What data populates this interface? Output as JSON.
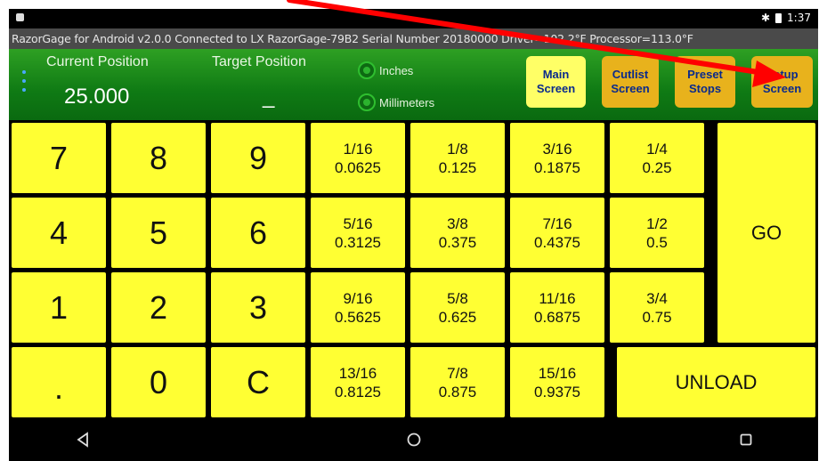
{
  "status_bar": {
    "time": "1:37"
  },
  "info_bar": {
    "text": "RazorGage for Android v2.0.0  Connected to LX RazorGage-79B2  Serial Number 20180000  Driver=102.2°F  Processor=113.0°F"
  },
  "header": {
    "current_position_label": "Current Position",
    "current_position_value": "25.000",
    "target_position_label": "Target Position",
    "target_position_value": "_",
    "unit_inches": "Inches",
    "unit_millimeters": "Millimeters"
  },
  "nav_buttons": {
    "main_line1": "Main",
    "main_line2": "Screen",
    "cutlist_line1": "Cutlist",
    "cutlist_line2": "Screen",
    "preset_line1": "Preset",
    "preset_line2": "Stops",
    "setup_line1": "Setup",
    "setup_line2": "Screen"
  },
  "keypad": {
    "digits": [
      "7",
      "8",
      "9",
      "4",
      "5",
      "6",
      "1",
      "2",
      "3",
      ".",
      "0",
      "C"
    ],
    "fractions": [
      {
        "frac": "1/16",
        "dec": "0.0625"
      },
      {
        "frac": "1/8",
        "dec": "0.125"
      },
      {
        "frac": "3/16",
        "dec": "0.1875"
      },
      {
        "frac": "1/4",
        "dec": "0.25"
      },
      {
        "frac": "5/16",
        "dec": "0.3125"
      },
      {
        "frac": "3/8",
        "dec": "0.375"
      },
      {
        "frac": "7/16",
        "dec": "0.4375"
      },
      {
        "frac": "1/2",
        "dec": "0.5"
      },
      {
        "frac": "9/16",
        "dec": "0.5625"
      },
      {
        "frac": "5/8",
        "dec": "0.625"
      },
      {
        "frac": "11/16",
        "dec": "0.6875"
      },
      {
        "frac": "3/4",
        "dec": "0.75"
      },
      {
        "frac": "13/16",
        "dec": "0.8125"
      },
      {
        "frac": "7/8",
        "dec": "0.875"
      },
      {
        "frac": "15/16",
        "dec": "0.9375"
      }
    ],
    "go_label": "GO",
    "unload_label": "UNLOAD"
  },
  "colors": {
    "key_yellow": "#ffff33",
    "nav_active": "#ffff66",
    "nav_inactive": "#e8b21c",
    "nav_text": "#0a2a8c",
    "header_green": "#1a8a1c",
    "annotation_arrow": "#ff0000"
  },
  "icons": {
    "back": "back-triangle-icon",
    "home": "home-circle-icon",
    "recents": "recents-square-icon",
    "bluetooth": "bluetooth-icon",
    "battery": "battery-icon"
  }
}
